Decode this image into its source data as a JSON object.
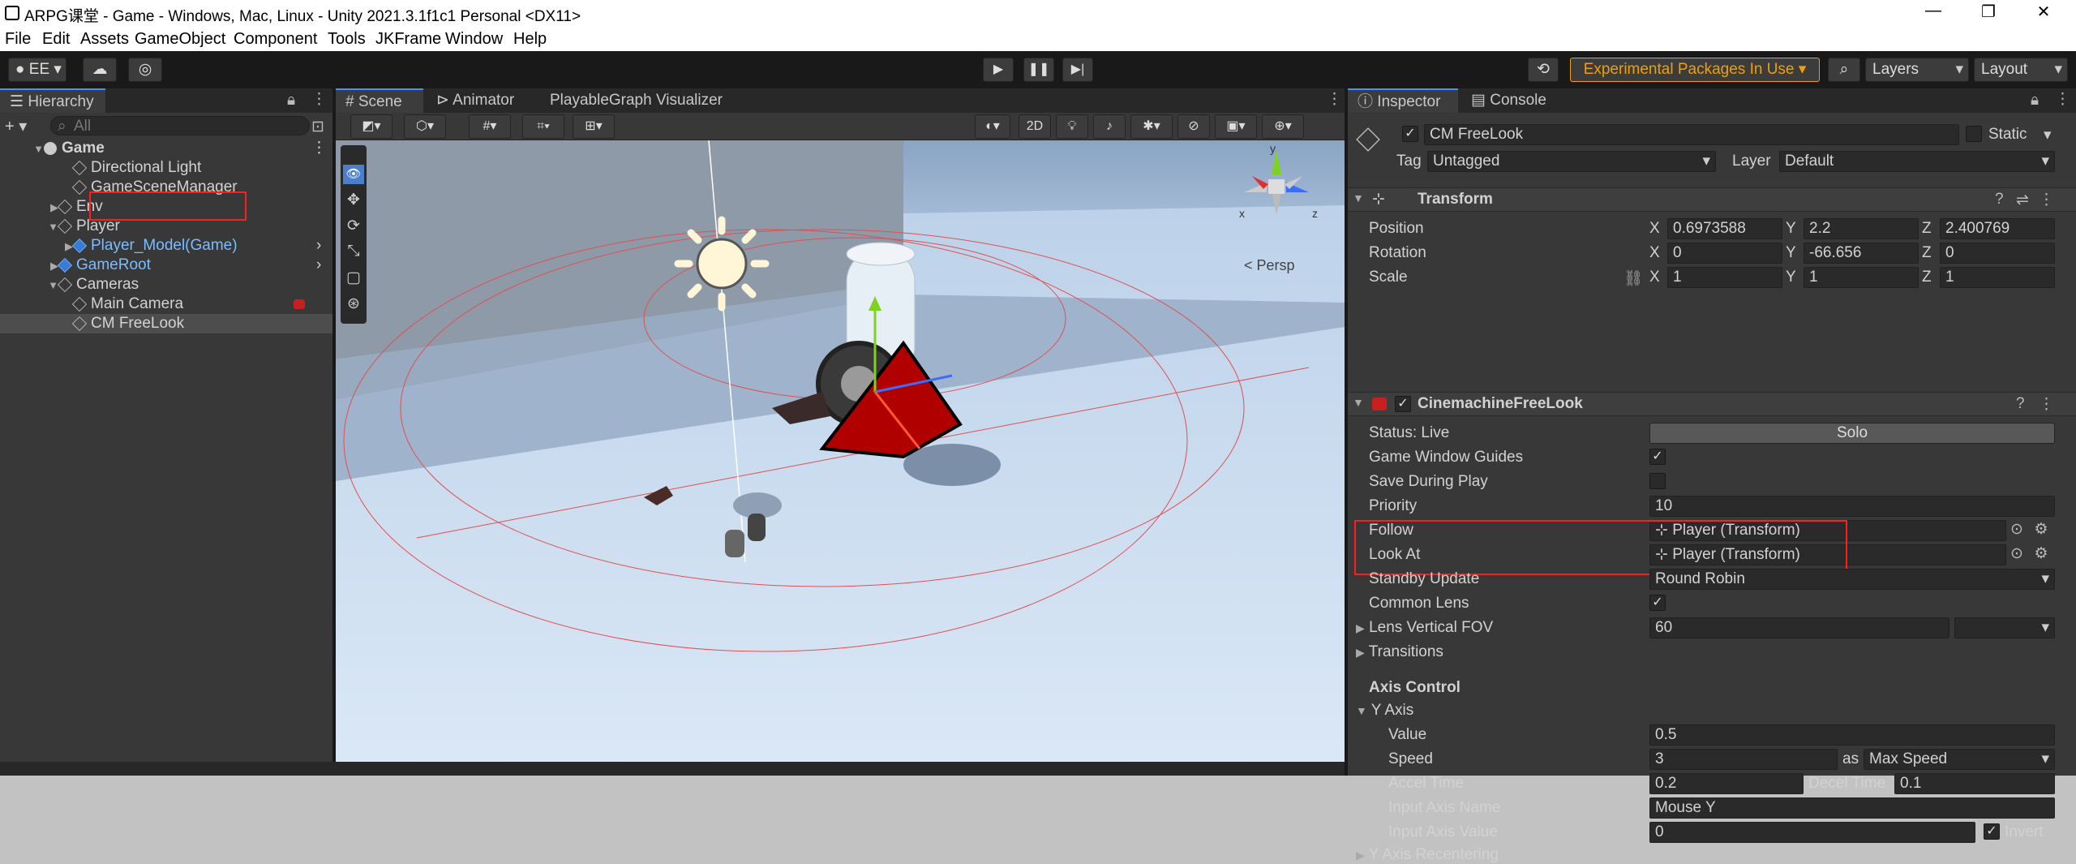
{
  "window": {
    "title": "ARPG课堂 - Game - Windows, Mac, Linux - Unity 2021.3.1f1c1 Personal <DX11>",
    "minimize": "—",
    "restore": "❐",
    "close": "✕"
  },
  "menu": [
    "File",
    "Edit",
    "Assets",
    "GameObject",
    "Component",
    "Tools",
    "JKFrame",
    "Window",
    "Help"
  ],
  "toolbar": {
    "account": "EE",
    "experimental": "Experimental Packages In Use ▾",
    "layers": "Layers",
    "layout": "Layout"
  },
  "hierarchy": {
    "tab": "Hierarchy",
    "search_placeholder": "All",
    "rows": [
      {
        "label": "Game",
        "indent": 0,
        "arrow": "▼",
        "kind": "scene"
      },
      {
        "label": "Directional Light",
        "indent": 2,
        "arrow": "",
        "kind": "cube"
      },
      {
        "label": "GameSceneManager",
        "indent": 2,
        "arrow": "",
        "kind": "cube"
      },
      {
        "label": "Env",
        "indent": 1,
        "arrow": "▶",
        "kind": "cube"
      },
      {
        "label": "Player",
        "indent": 1,
        "arrow": "▼",
        "kind": "cube"
      },
      {
        "label": "Player_Model(Game)",
        "indent": 2,
        "arrow": "▶",
        "kind": "blue"
      },
      {
        "label": "GameRoot",
        "indent": 1,
        "arrow": "▶",
        "kind": "blue"
      },
      {
        "label": "Cameras",
        "indent": 1,
        "arrow": "▼",
        "kind": "cube"
      },
      {
        "label": "Main Camera",
        "indent": 2,
        "arrow": "",
        "kind": "cube"
      },
      {
        "label": "CM FreeLook",
        "indent": 2,
        "arrow": "",
        "kind": "cube"
      }
    ]
  },
  "scene": {
    "tabs": [
      "Scene",
      "Animator",
      "PlayableGraph Visualizer"
    ],
    "mode_2d": "2D",
    "persp": "Persp",
    "gizmo_x": "x",
    "gizmo_y": "y",
    "gizmo_z": "z"
  },
  "inspector": {
    "tabs": [
      "Inspector",
      "Console"
    ],
    "object_name": "CM FreeLook",
    "static": "Static",
    "tag_label": "Tag",
    "tag_value": "Untagged",
    "layer_label": "Layer",
    "layer_value": "Default",
    "transform": {
      "title": "Transform",
      "position_label": "Position",
      "rotation_label": "Rotation",
      "scale_label": "Scale",
      "position": [
        "0.6973588",
        "2.2",
        "2.400769"
      ],
      "rotation": [
        "0",
        "-66.656",
        "0"
      ],
      "scale": [
        "1",
        "1",
        "1"
      ],
      "x": "X",
      "y": "Y",
      "z": "Z"
    },
    "freelook": {
      "title": "CinemachineFreeLook",
      "status": "Status: Live",
      "solo": "Solo",
      "guides": "Game Window Guides",
      "save": "Save During Play",
      "priority_label": "Priority",
      "priority": "10",
      "follow_label": "Follow",
      "follow": "Player (Transform)",
      "lookat_label": "Look At",
      "lookat": "Player (Transform)",
      "standby_label": "Standby Update",
      "standby": "Round Robin",
      "common_lens": "Common Lens",
      "fov_label": "Lens Vertical FOV",
      "fov": "60",
      "transitions": "Transitions",
      "axis_control": "Axis Control",
      "y_axis": "Y Axis",
      "value_label": "Value",
      "value": "0.5",
      "speed_label": "Speed",
      "speed": "3",
      "as": "as",
      "speed_mode": "Max Speed",
      "accel_label": "Accel Time",
      "accel": "0.2",
      "decel_label": "Decel Time",
      "decel": "0.1",
      "input_name_label": "Input Axis Name",
      "input_name": "Mouse Y",
      "input_value_label": "Input Axis Value",
      "input_value": "0",
      "invert": "Invert",
      "recentering": "Y Axis Recentering"
    }
  },
  "colors": {
    "accent": "#4e8cff",
    "highlight": "#ff1e1e",
    "experimental": "#f0a000"
  }
}
